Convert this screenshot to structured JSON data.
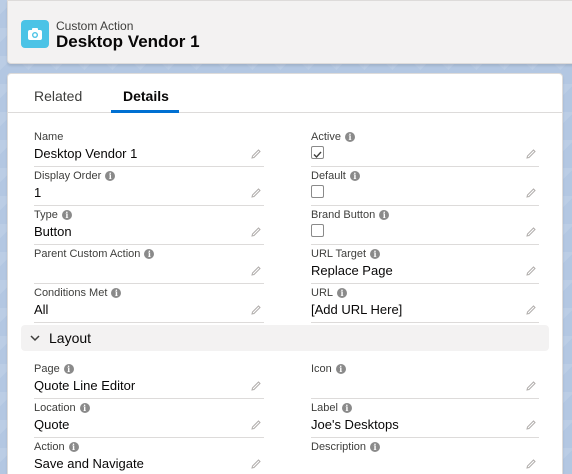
{
  "header": {
    "subtitle": "Custom Action",
    "title": "Desktop Vendor 1",
    "icon": "camera-icon",
    "icon_color": "#4bc3e6"
  },
  "tabs": [
    {
      "label": "Related",
      "active": false
    },
    {
      "label": "Details",
      "active": true
    }
  ],
  "accent_color": "#0070d2",
  "details": {
    "name": {
      "label": "Name",
      "value": "Desktop Vendor 1"
    },
    "active": {
      "label": "Active",
      "checked": true
    },
    "display_order": {
      "label": "Display Order",
      "value": "1"
    },
    "default": {
      "label": "Default",
      "checked": false
    },
    "type": {
      "label": "Type",
      "value": "Button"
    },
    "brand_button": {
      "label": "Brand Button",
      "checked": false
    },
    "parent_custom_action": {
      "label": "Parent Custom Action",
      "value": ""
    },
    "url_target": {
      "label": "URL Target",
      "value": "Replace Page"
    },
    "conditions_met": {
      "label": "Conditions Met",
      "value": "All"
    },
    "url": {
      "label": "URL",
      "value": "[Add URL Here]"
    }
  },
  "layout_section": {
    "title": "Layout",
    "page": {
      "label": "Page",
      "value": "Quote Line Editor"
    },
    "icon": {
      "label": "Icon",
      "value": ""
    },
    "location": {
      "label": "Location",
      "value": "Quote"
    },
    "label": {
      "label": "Label",
      "value": "Joe's Desktops"
    },
    "action": {
      "label": "Action",
      "value": "Save and Navigate"
    },
    "description": {
      "label": "Description",
      "value": ""
    }
  }
}
